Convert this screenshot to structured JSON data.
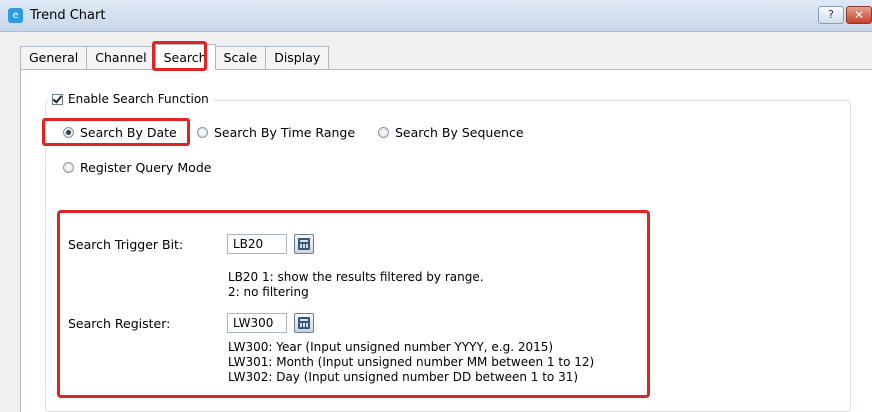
{
  "window": {
    "title": "Trend Chart",
    "help_label": "?",
    "close_label": "✕"
  },
  "tabs": [
    "General",
    "Channel",
    "Search",
    "Scale",
    "Display"
  ],
  "active_tab": "Search",
  "search": {
    "enable_label": "Enable Search Function",
    "enable_checked": true,
    "modes": [
      {
        "label": "Search By Date",
        "checked": true
      },
      {
        "label": "Search By Time Range",
        "checked": false
      },
      {
        "label": "Search By Sequence",
        "checked": false
      },
      {
        "label": "Register Query Mode",
        "checked": false
      }
    ],
    "trigger_bit": {
      "label": "Search Trigger Bit:",
      "value": "LB20",
      "desc": [
        "LB20 1: show the results filtered by range.",
        "2: no filtering"
      ]
    },
    "register": {
      "label": "Search Register:",
      "value": "LW300",
      "desc": [
        "LW300: Year (Input unsigned number YYYY, e.g. 2015)",
        "LW301: Month (Input unsigned number MM between 1 to 12)",
        "LW302: Day (Input unsigned number DD between 1 to 31)"
      ]
    }
  },
  "colors": {
    "highlight": "#e02424"
  }
}
